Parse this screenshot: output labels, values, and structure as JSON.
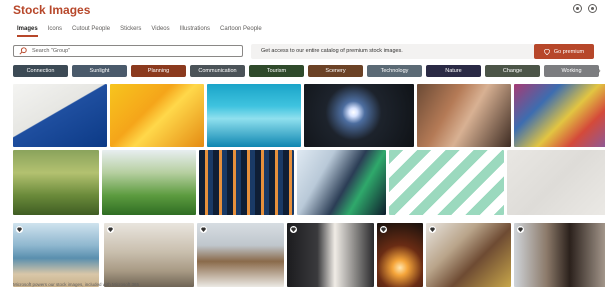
{
  "title": "Stock Images",
  "header_icons": [
    "smiley-icon",
    "help-icon"
  ],
  "tabs": [
    {
      "label": "Images",
      "active": true
    },
    {
      "label": "Icons",
      "active": false
    },
    {
      "label": "Cutout People",
      "active": false
    },
    {
      "label": "Stickers",
      "active": false
    },
    {
      "label": "Videos",
      "active": false
    },
    {
      "label": "Illustrations",
      "active": false
    },
    {
      "label": "Cartoon People",
      "active": false
    }
  ],
  "search": {
    "value": "Search \"Group\"",
    "icon": "search-icon"
  },
  "promo": {
    "text": "Get access to our entire catalog of premium stock images.",
    "button_label": "Go premium",
    "button_icon": "diamond-icon",
    "accent": "#b7472a"
  },
  "categories": [
    {
      "label": "Connection",
      "color": "#3c4a55"
    },
    {
      "label": "Sunlight",
      "color": "#4a5a6b"
    },
    {
      "label": "Planning",
      "color": "#8b3a1e"
    },
    {
      "label": "Communication",
      "color": "#4b5358"
    },
    {
      "label": "Tourism",
      "color": "#2f4a2b"
    },
    {
      "label": "Scenery",
      "color": "#6b4226"
    },
    {
      "label": "Technology",
      "color": "#5b6a75"
    },
    {
      "label": "Nature",
      "color": "#2a2a45"
    },
    {
      "label": "Change",
      "color": "#4c5548"
    },
    {
      "label": "Working",
      "color": "#7c7d80"
    }
  ],
  "chip_next_icon": "chevron-right-icon",
  "photos": [
    {
      "name": "photo-white-curve",
      "premium": false,
      "bg": "linear-gradient(150deg,#f4f4f2 0%,#e6e6e2 45%,#1f4fa0 46%,#0c3a86 100%)"
    },
    {
      "name": "photo-yellow-waves",
      "premium": false,
      "bg": "linear-gradient(135deg,#f7c51e 0%,#f5a51a 40%,#ffd84a 55%,#e48a12 100%)"
    },
    {
      "name": "photo-pool-water",
      "premium": false,
      "bg": "linear-gradient(180deg,#1aa4c8 0%,#3fc3df 35%,#8fe0ee 55%,#0f86b1 100%)"
    },
    {
      "name": "photo-welding-sparks",
      "premium": false,
      "bg": "radial-gradient(circle at 45% 45%,#ffffff 0%,#d7e3ff 6%,#4d6ea0 16%,#1d232c 40%,#0f1216 100%)"
    },
    {
      "name": "photo-craft-workbench",
      "premium": false,
      "bg": "linear-gradient(120deg,#6b4a35 0%,#b47a56 35%,#d8b193 55%,#3d2b22 100%)"
    },
    {
      "name": "photo-paint-beads",
      "premium": false,
      "bg": "linear-gradient(135deg,#a63b74 0%,#3d6db0 30%,#e2c542 55%,#d44a3a 75%,#8b5a9a 100%)"
    },
    {
      "name": "photo-hand-in-wheat",
      "premium": false,
      "bg": "linear-gradient(180deg,#8aa35c 0%,#b3c170 35%,#6a8a3a 70%,#3f5d23 100%)"
    },
    {
      "name": "photo-glove-seedling",
      "premium": false,
      "bg": "linear-gradient(180deg,#e7eef0 0%,#b6cfa0 35%,#5c9b3f 70%,#2f6d23 100%)"
    },
    {
      "name": "photo-building-facade",
      "premium": false,
      "bg": "repeating-linear-gradient(90deg,#0f1e35 0 6px,#e7903c 6px 9px,#1a3a66 9px 14px),linear-gradient(#11305a,#0d2340)"
    },
    {
      "name": "photo-stock-screen",
      "premium": false,
      "bg": "linear-gradient(120deg,#dfe9f2 0%,#b9c9d8 30%,#2b3d55 55%,#2fa96b 70%,#0d1b2b 100%)"
    },
    {
      "name": "photo-green-stripes",
      "premium": false,
      "bg": "repeating-linear-gradient(135deg,#9bd9be 0 10px,#ffffff 10px 20px)"
    },
    {
      "name": "photo-gray-texture",
      "premium": false,
      "bg": "linear-gradient(135deg,#e9e7e3 0%,#dedcd8 50%,#ebe9e5 100%)"
    },
    {
      "name": "photo-beach-couple",
      "premium": true,
      "bg": "linear-gradient(180deg,#cfe3ee 0%,#8fb7cf 35%,#5a8fae 55%,#d9c7a8 80%,#c8b08a 100%)"
    },
    {
      "name": "photo-wedding-street",
      "premium": true,
      "bg": "linear-gradient(180deg,#e9e5de 0%,#c9bfae 45%,#a89a84 75%,#6f6455 100%)"
    },
    {
      "name": "photo-man-laptop",
      "premium": true,
      "bg": "linear-gradient(180deg,#d7dde2 0%,#bfc6cc 35%,#8a6a4a 60%,#ece9e4 100%)"
    },
    {
      "name": "photo-bride-hands",
      "premium": true,
      "bg": "linear-gradient(90deg,#1c1c1e 0%,#3a3a3d 35%,#f0ece6 55%,#2a2a2c 100%)"
    },
    {
      "name": "photo-rocket-launch",
      "premium": true,
      "bg": "radial-gradient(circle at 50% 70%,#ffe6b0 0%,#f5a53a 15%,#6a2c14 45%,#16100d 100%)"
    },
    {
      "name": "photo-couple-laughing",
      "premium": true,
      "bg": "linear-gradient(135deg,#e8e4df 0%,#b9a48a 35%,#6e4b33 60%,#c7a64a 100%)"
    },
    {
      "name": "photo-barber",
      "premium": true,
      "bg": "linear-gradient(90deg,#cfd4d9 0%,#8c7a6a 35%,#2b211c 60%,#a99c90 100%)"
    }
  ],
  "footer_note": "Microsoft powers our stock images, included with Microsoft 365"
}
